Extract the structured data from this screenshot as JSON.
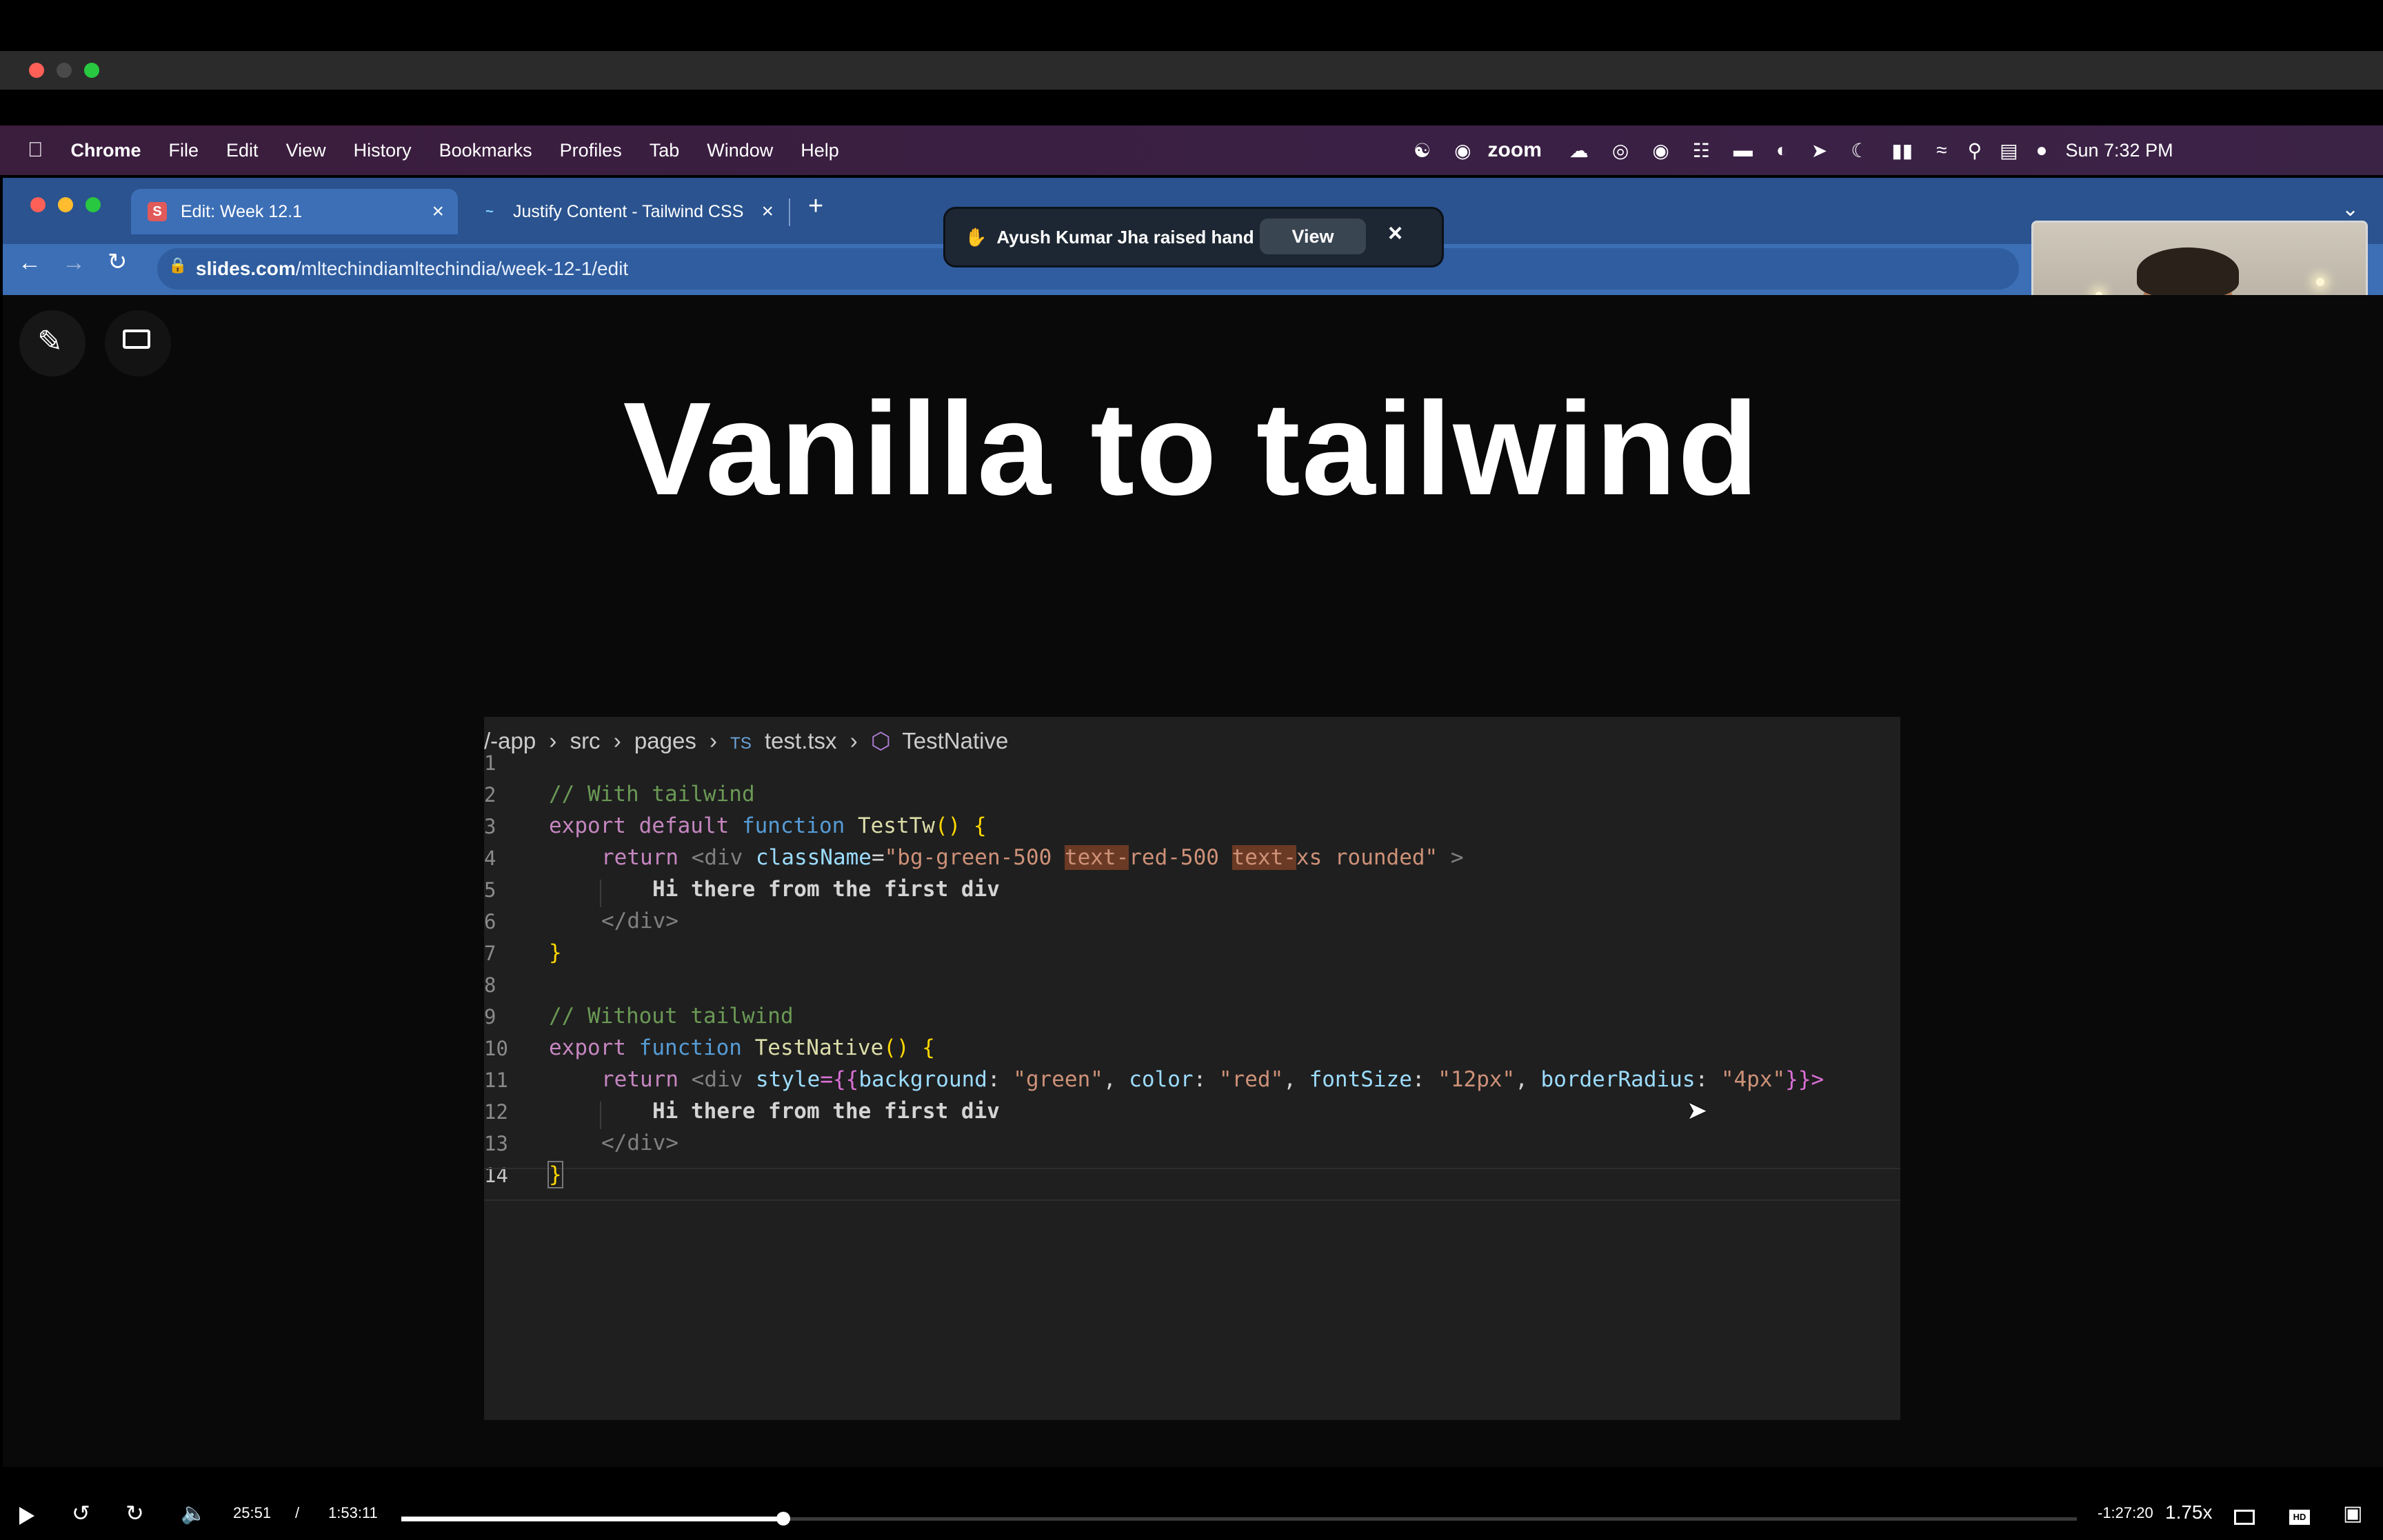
{
  "menubar": {
    "app": "Chrome",
    "items": [
      "File",
      "Edit",
      "View",
      "History",
      "Bookmarks",
      "Profiles",
      "Tab",
      "Window",
      "Help"
    ],
    "tray_zoom": "zoom",
    "clock": "Sun 7:32 PM"
  },
  "browser": {
    "tabs": [
      {
        "label": "Edit: Week 12.1",
        "icon": "S",
        "active": true
      },
      {
        "label": "Justify Content - Tailwind CSS",
        "icon": "~",
        "active": false
      }
    ],
    "new_tab": "+",
    "url_domain": "slides.com",
    "url_path": "/mltechindiamltechindia/week-12-1/edit"
  },
  "notification": {
    "text": "Ayush Kumar Jha raised hand",
    "view_label": "View"
  },
  "slide": {
    "title": "Vanilla to tailwind",
    "breadcrumb": {
      "seg1": "/-app",
      "seg2": "src",
      "seg3": "pages",
      "ts": "TS",
      "file": "test.tsx",
      "symbol": "TestNative"
    },
    "line_numbers": [
      "1",
      "2",
      "3",
      "4",
      "5",
      "6",
      "7",
      "8",
      "9",
      "10",
      "11",
      "12",
      "13",
      "14"
    ],
    "code": {
      "l2": "// With tailwind",
      "l3_kw1": "export",
      "l3_kw2": "default",
      "l3_kw3": "function",
      "l3_fn": "TestTw",
      "l3_rest": "() {",
      "l4_ret": "return",
      "l4_tagopen": "<div",
      "l4_attr": "className",
      "l4_eq": "=",
      "l4_str1": "\"bg-green-500 ",
      "l4_hl1": "text-",
      "l4_str2": "red-500 ",
      "l4_hl2": "text-",
      "l4_str3": "xs rounded\"",
      "l4_close": " >",
      "l5": "Hi there from the first div",
      "l6": "</div>",
      "l7": "}",
      "l9": "// Without tailwind",
      "l10_kw1": "export",
      "l10_kw2": "function",
      "l10_fn": "TestNative",
      "l10_rest": "() {",
      "l11_ret": "return",
      "l11_tagopen": "<div",
      "l11_attr": "style",
      "l11_open": "={{",
      "l11_k1": "background",
      "l11_v1": "\"green\"",
      "l11_k2": "color",
      "l11_v2": "\"red\"",
      "l11_k3": "fontSize",
      "l11_v3": "\"12px\"",
      "l11_k4": "borderRadius",
      "l11_v4": "\"4px\"",
      "l11_close": "}}>",
      "l12": "Hi there from the first div",
      "l13": "</div>",
      "l14": "}"
    }
  },
  "player": {
    "current_time": "25:51",
    "separator": "/",
    "duration": "1:53:11",
    "remaining": "-1:27:20",
    "speed": "1.75x",
    "progress_fraction": 0.228
  },
  "colors": {
    "menubar": "#3b1d3d",
    "browser_tabstrip": "#2a538f",
    "active_tab": "#3c6fb6",
    "slide_bg": "#090909",
    "editor_bg": "#1f1f1f"
  }
}
